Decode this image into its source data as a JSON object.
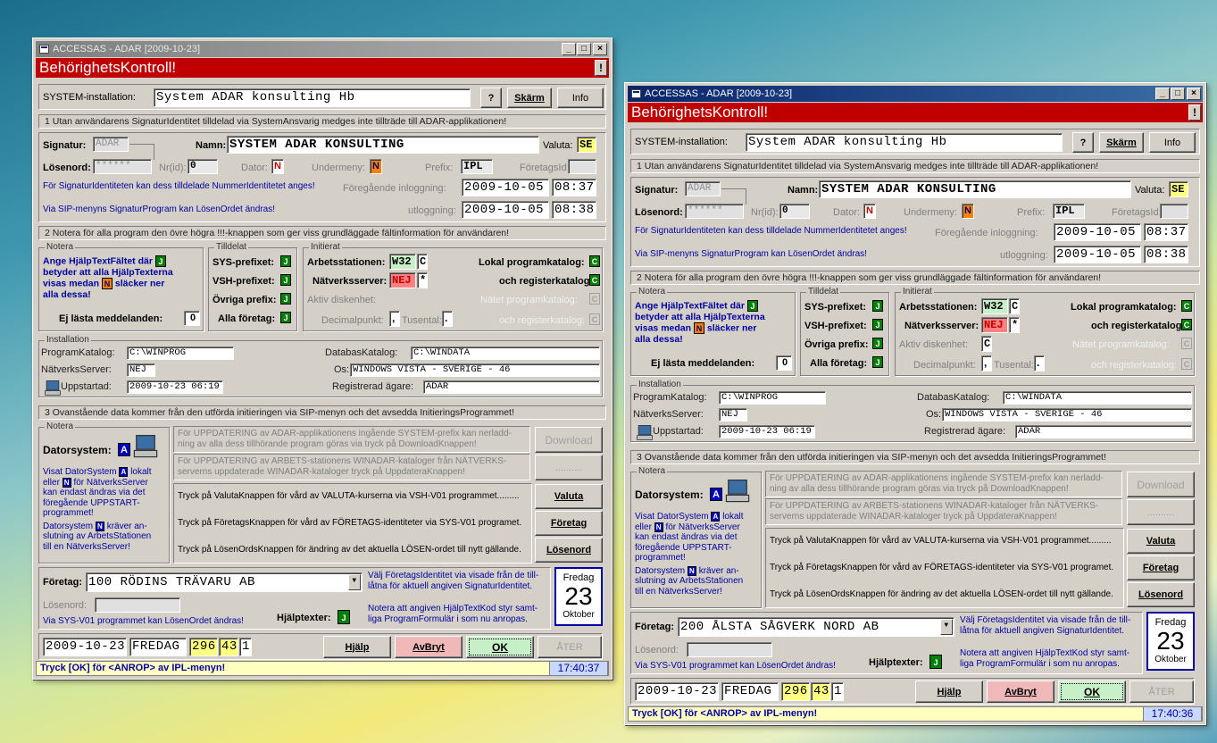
{
  "windows": [
    {
      "title": "ACCESSAS - ADAR [2009-10-23]",
      "banner": "BehörighetsKontroll!",
      "system_label": "SYSTEM-installation:",
      "system_value": "System ADAR konsulting Hb",
      "btn_help_q": "?",
      "btn_skarm": "Skärm",
      "btn_info": "Info",
      "sec1": "1   Utan användarens SignaturIdentitet tilldelad via SystemAnsvarig medges inte tillträde till ADAR-applikationen!",
      "signatur_label": "Signatur:",
      "signatur_value": "ADAR",
      "namn_label": "Namn:",
      "namn_value": "SYSTEM ADAR KONSULTING",
      "valuta_label": "Valuta:",
      "valuta_value": "SE",
      "losenord_label": "Lösenord:",
      "losenord_value": "******",
      "nrid_label": "Nr(id):",
      "nrid_value": "0",
      "dator_label": "Dator:",
      "dator_value": "N",
      "undermeny_label": "Undermeny:",
      "undermeny_value": "N",
      "prefix_label": "Prefix:",
      "prefix_value": "IPL",
      "foretagsid_label": "FöretagsId:",
      "info_nummer": "För SignaturIdentiteten kan dess tilldelade NummerIdentitetet anges!",
      "info_sip": "Via SIP-menyns SignaturProgram kan LösenOrdet ändras!",
      "foregaende_label": "Föregående inloggning:",
      "inlogg_date": "2009-10-05",
      "inlogg_time": "08:37",
      "utlogg_label": "utloggning:",
      "utlogg_date": "2009-10-05",
      "utlogg_time": "08:38",
      "sec2": "2   Notera för alla program den övre högra !!!-knappen som ger viss grundläggade fältinformation för användaren!",
      "notera_cap": "Notera",
      "notera_text1": "Ange HjälpTextFältet där",
      "notera_text2": "betyder att alla HjälpTexterna",
      "notera_text3": "visas medan",
      "notera_text4": "släcker ner",
      "notera_text5": "alla dessa!",
      "j": "J",
      "n": "N",
      "ej_lasta": "Ej lästa meddelanden:",
      "ej_lasta_value": "0",
      "tilldelat_cap": "Tilldelat",
      "sys_prefixet": "SYS-prefixet:",
      "vsh_prefixet": "VSH-prefixet:",
      "ovriga_prefix": "Övriga prefix:",
      "alla_foretag": "Alla företag:",
      "initierat_cap": "Initierat",
      "arbetsstationen": "Arbetsstationen:",
      "arbetsstationen_value": "W32",
      "c": "C",
      "natverksserver": "Nätverksserver:",
      "natverksserver_value": "NEJ",
      "star": "*",
      "aktiv_disk": "Aktiv diskenhet:",
      "decimalpunkt": "Decimalpunkt:",
      "decimal_value": ",",
      "tusental": "Tusental:",
      "tusental_value": ".",
      "lokal_prog": "Lokal programkatalog:",
      "och_register": "och registerkatalog:",
      "natet_prog": "Nätet programkatalog:",
      "och_register2": "och registerkatalog:",
      "inst_cap": "Installation",
      "programkatalog_label": "ProgramKatalog:",
      "programkatalog_value": "C:\\WINPROG",
      "databaskatalog_label": "DatabasKatalog:",
      "databaskatalog_value": "C:\\WINDATA",
      "natverksserver2_label": "NätverksServer:",
      "natverksserver2_value": "NEJ",
      "os_label": "Os:",
      "os_value": "WINDOWS VISTA - SVERIGE - 46",
      "uppstartad_label": "Uppstartad:",
      "uppstartad_value": "2009-10-23 06:19",
      "agare_label": "Registrerad ägare:",
      "agare_value": "ADAR",
      "sec3": "3   Ovanstående data kommer från den utförda initieringen via SIP-menyn och det avsedda InitieringsProgrammet!",
      "datorsystem_label": "Datorsystem:",
      "datorsystem_value": "A",
      "visat1": "Visat DatorSystem",
      "visat2": "lokalt",
      "visat3": "eller",
      "visat4": "för NätverksServer",
      "visat5": "kan endast ändras via det",
      "visat6": "föregående UPPSTART-",
      "visat7": "programmet!",
      "ds1": "Datorsystem",
      "ds2": "kräver an-",
      "ds3": "slutning av ArbetsStationen",
      "ds4": "till en NätverksServer!",
      "upp1": "För UPPDATERING av ADAR-applikationens ingående SYSTEM-prefix kan nerladd-ning av alla dess tillhörande program göras via tryck på DownloadKnappen!",
      "upp2": "För UPPDATERING av ARBETS-stationens WINADAR-kataloger från NÄTVERKS-serverns uppdaterade WINADAR-kataloger tryck på UppdateraKnappen!",
      "btn_download": "Download",
      "btn_dots": "..........",
      "tryck_valuta": "Tryck på ValutaKnappen för vård av VALUTA-kurserna via VSH-V01 programmet.........",
      "tryck_foretag": "Tryck på FöretagsKnappen för vård av FÖRETAGS-identiteter via SYS-V01 programet.",
      "tryck_losen": "Tryck på LösenOrdsKnappen för ändring av det aktuella LÖSEN-ordet till nytt gällande.",
      "btn_valuta": "Valuta",
      "btn_foretag": "Företag",
      "btn_losenord": "Lösenord",
      "foretag_label": "Företag:",
      "foretag_value": "100 RÖDINS TRÄVARU AB",
      "valj1": "Välj FöretagsIdentitet via visade från de till-",
      "valj2": "låtna för aktuell angiven SignaturIdentitet.",
      "losen2_label": "Lösenord:",
      "via_sys": "Via SYS-V01 programmet kan LösenOrdet ändras!",
      "hjalptexter_label": "Hjälptexter:",
      "notera_hj1": "Notera att angiven HjälpTextKod styr samt-",
      "notera_hj2": "liga ProgramFormulär i som nu anropas.",
      "cal_day": "Fredag",
      "cal_num": "23",
      "cal_month": "Oktober",
      "bot_date": "2009-10-23",
      "bot_day": "FREDAG",
      "bot_n1": "296",
      "bot_n2": "43",
      "bot_n3": "1",
      "btn_hjalp": "Hjälp",
      "btn_avbryt": "AvBryt",
      "btn_ok": "OK",
      "btn_ater": "ÅTER",
      "status": "Tryck [OK] för <ANROP> av IPL-menyn!",
      "clock": "17:40:37"
    },
    {
      "title": "ACCESSAS - ADAR [2009-10-23]",
      "banner": "BehörighetsKontroll!",
      "system_label": "SYSTEM-installation:",
      "system_value": "System ADAR konsulting Hb",
      "btn_help_q": "?",
      "btn_skarm": "Skärm",
      "btn_info": "Info",
      "sec1": "1   Utan användarens SignaturIdentitet tilldelad via SystemAnsvarig medges inte tillträde till ADAR-applikationen!",
      "signatur_label": "Signatur:",
      "signatur_value": "ADAR",
      "namn_label": "Namn:",
      "namn_value": "SYSTEM ADAR KONSULTING",
      "valuta_label": "Valuta:",
      "valuta_value": "SE",
      "losenord_label": "Lösenord:",
      "losenord_value": "******",
      "nrid_label": "Nr(id):",
      "nrid_value": "0",
      "dator_label": "Dator:",
      "dator_value": "N",
      "undermeny_label": "Undermeny:",
      "undermeny_value": "N",
      "prefix_label": "Prefix:",
      "prefix_value": "IPL",
      "foretagsid_label": "FöretagsId:",
      "info_nummer": "För SignaturIdentiteten kan dess tilldelade NummerIdentitetet anges!",
      "info_sip": "Via SIP-menyns SignaturProgram kan LösenOrdet ändras!",
      "foregaende_label": "Föregående inloggning:",
      "inlogg_date": "2009-10-05",
      "inlogg_time": "08:37",
      "utlogg_label": "utloggning:",
      "utlogg_date": "2009-10-05",
      "utlogg_time": "08:38",
      "sec2": "2   Notera för alla program den övre högra !!!-knappen som ger viss grundläggade fältinformation för användaren!",
      "notera_cap": "Notera",
      "notera_text1": "Ange HjälpTextFältet där",
      "notera_text2": "betyder att alla HjälpTexterna",
      "notera_text3": "visas medan",
      "notera_text4": "släcker ner",
      "notera_text5": "alla dessa!",
      "j": "J",
      "n": "N",
      "ej_lasta": "Ej lästa meddelanden:",
      "ej_lasta_value": "0",
      "tilldelat_cap": "Tilldelat",
      "sys_prefixet": "SYS-prefixet:",
      "vsh_prefixet": "VSH-prefixet:",
      "ovriga_prefix": "Övriga prefix:",
      "alla_foretag": "Alla företag:",
      "initierat_cap": "Initierat",
      "arbetsstationen": "Arbetsstationen:",
      "arbetsstationen_value": "W32",
      "c": "C",
      "natverksserver": "Nätverksserver:",
      "natverksserver_value": "NEJ",
      "star": "*",
      "aktiv_disk": "Aktiv diskenhet:",
      "aktiv_value": "C",
      "decimalpunkt": "Decimalpunkt:",
      "decimal_value": ",",
      "tusental": "Tusental:",
      "tusental_value": ".",
      "lokal_prog": "Lokal programkatalog:",
      "och_register": "och registerkatalog:",
      "natet_prog": "Nätet programkatalog:",
      "och_register2": "och registerkatalog:",
      "inst_cap": "Installation",
      "programkatalog_label": "ProgramKatalog:",
      "programkatalog_value": "C:\\WINPROG",
      "databaskatalog_label": "DatabasKatalog:",
      "databaskatalog_value": "C:\\WINDATA",
      "natverksserver2_label": "NätverksServer:",
      "natverksserver2_value": "NEJ",
      "os_label": "Os:",
      "os_value": "WINDOWS VISTA - SVERIGE - 46",
      "uppstartad_label": "Uppstartad:",
      "uppstartad_value": "2009-10-23 06:19",
      "agare_label": "Registrerad ägare:",
      "agare_value": "ADAR",
      "sec3": "3   Ovanstående data kommer från den utförda initieringen via SIP-menyn och det avsedda InitieringsProgrammet!",
      "datorsystem_label": "Datorsystem:",
      "datorsystem_value": "A",
      "visat1": "Visat DatorSystem",
      "visat2": "lokalt",
      "visat3": "eller",
      "visat4": "för NätverksServer",
      "visat5": "kan endast ändras via det",
      "visat6": "föregående UPPSTART-",
      "visat7": "programmet!",
      "ds1": "Datorsystem",
      "ds2": "kräver an-",
      "ds3": "slutning av ArbetsStationen",
      "ds4": "till en NätverksServer!",
      "upp1": "För UPPDATERING av ADAR-applikationens ingående SYSTEM-prefix kan nerladd-ning av alla dess tillhörande program göras via tryck på DownloadKnappen!",
      "upp2": "För UPPDATERING av ARBETS-stationens WINADAR-kataloger från NÄTVERKS-serverns uppdaterade WINADAR-kataloger tryck på UppdateraKnappen!",
      "btn_download": "Download",
      "btn_dots": "..........",
      "tryck_valuta": "Tryck på ValutaKnappen för vård av VALUTA-kurserna via VSH-V01 programmet.........",
      "tryck_foretag": "Tryck på FöretagsKnappen för vård av FÖRETAGS-identiteter via SYS-V01 programet.",
      "tryck_losen": "Tryck på LösenOrdsKnappen för ändring av det aktuella LÖSEN-ordet till nytt gällande.",
      "btn_valuta": "Valuta",
      "btn_foretag": "Företag",
      "btn_losenord": "Lösenord",
      "foretag_label": "Företag:",
      "foretag_value": "200 ÅLSTA SÅGVERK NORD AB",
      "valj1": "Välj FöretagsIdentitet via visade från de till-",
      "valj2": "låtna för aktuell angiven SignaturIdentitet.",
      "losen2_label": "Lösenord:",
      "via_sys": "Via SYS-V01 programmet kan LösenOrdet ändras!",
      "hjalptexter_label": "Hjälptexter:",
      "notera_hj1": "Notera att angiven HjälpTextKod styr samt-",
      "notera_hj2": "liga ProgramFormulär i som nu anropas.",
      "cal_day": "Fredag",
      "cal_num": "23",
      "cal_month": "Oktober",
      "bot_date": "2009-10-23",
      "bot_day": "FREDAG",
      "bot_n1": "296",
      "bot_n2": "43",
      "bot_n3": "1",
      "btn_hjalp": "Hjälp",
      "btn_avbryt": "AvBryt",
      "btn_ok": "OK",
      "btn_ater": "ÅTER",
      "status": "Tryck [OK] för <ANROP> av IPL-menyn!",
      "clock": "17:40:36"
    }
  ],
  "colors": {
    "banner": "#c00000",
    "active_title": "#0a246a",
    "status_bg": "#ffffc0",
    "ok_bg": "#c8f0c8",
    "avbryt_bg": "#f0b8b8"
  }
}
